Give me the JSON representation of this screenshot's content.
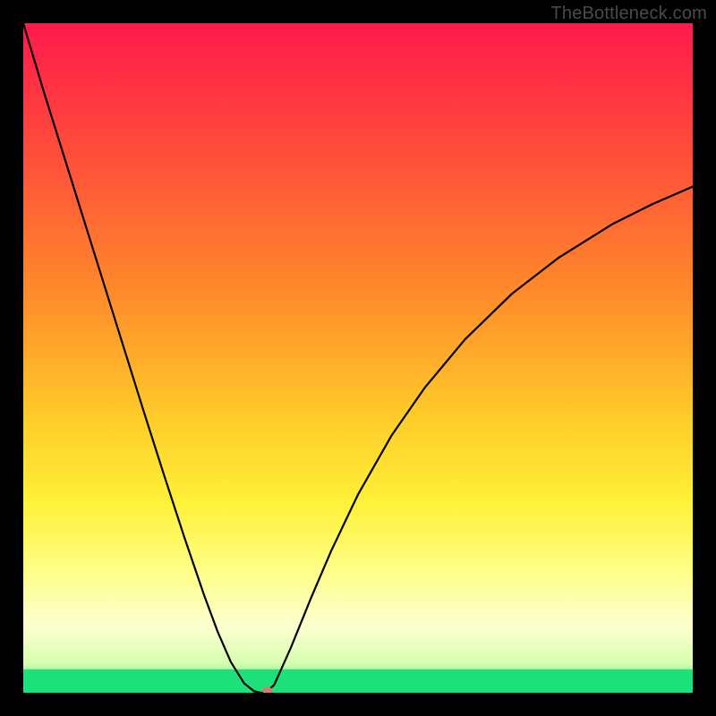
{
  "watermark": "TheBottleneck.com",
  "chart_data": {
    "type": "line",
    "title": "",
    "xlabel": "",
    "ylabel": "",
    "xlim": [
      0,
      100
    ],
    "ylim": [
      0,
      100
    ],
    "gradient_stops": [
      {
        "offset": 0.0,
        "color": "#ff1a4b"
      },
      {
        "offset": 0.2,
        "color": "#ff4f3a"
      },
      {
        "offset": 0.4,
        "color": "#ff8a2a"
      },
      {
        "offset": 0.6,
        "color": "#ffcf2a"
      },
      {
        "offset": 0.72,
        "color": "#fff23a"
      },
      {
        "offset": 0.82,
        "color": "#ffff8a"
      },
      {
        "offset": 0.9,
        "color": "#fdffd0"
      },
      {
        "offset": 0.955,
        "color": "#d8ffb0"
      },
      {
        "offset": 0.985,
        "color": "#6bf08a"
      },
      {
        "offset": 1.0,
        "color": "#1ee07a"
      }
    ],
    "series": [
      {
        "name": "bottleneck-curve",
        "x": [
          0.0,
          3.0,
          6.0,
          9.0,
          12.0,
          15.0,
          18.0,
          21.0,
          24.0,
          27.0,
          29.0,
          31.0,
          33.0,
          34.5,
          35.5,
          36.2,
          37.5,
          40.0,
          43.0,
          46.0,
          50.0,
          55.0,
          60.0,
          66.0,
          73.0,
          80.0,
          88.0,
          94.0,
          100.0
        ],
        "y": [
          100.0,
          90.0,
          80.4,
          70.8,
          61.2,
          51.6,
          42.0,
          32.6,
          23.4,
          14.6,
          9.2,
          4.6,
          1.4,
          0.2,
          0.0,
          0.0,
          1.2,
          6.8,
          14.2,
          21.2,
          29.6,
          38.4,
          45.6,
          52.8,
          59.6,
          65.0,
          70.0,
          73.0,
          75.6
        ]
      }
    ],
    "marker": {
      "x": 36.5,
      "y": 0.3,
      "color": "#d47a6e",
      "rx": 6,
      "ry": 4
    },
    "green_band": {
      "y_from": 0,
      "y_to": 3.5
    }
  }
}
